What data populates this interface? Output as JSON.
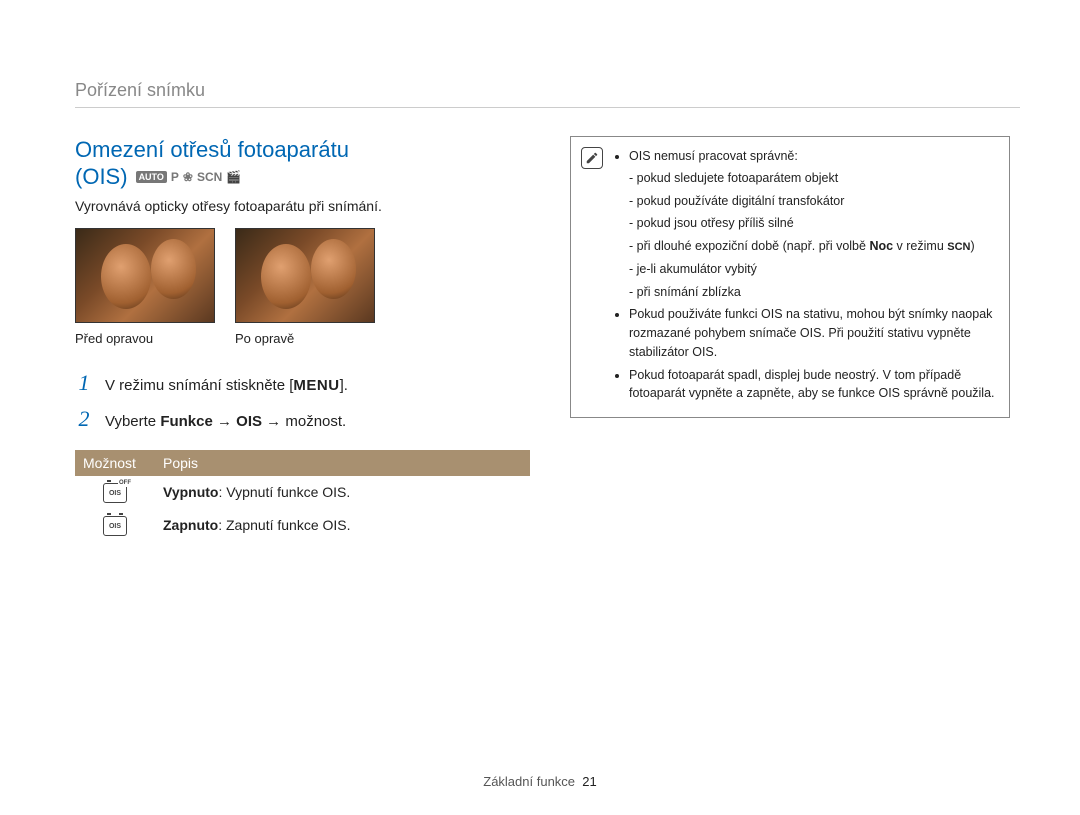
{
  "section_header": "Pořízení snímku",
  "title_line1": "Omezení otřesů fotoaparátu",
  "title_line2": "(OIS)",
  "mode_icons": {
    "auto": "AUTO",
    "p": "P",
    "plant": "❀",
    "scn": "SCN",
    "movie": "🎬"
  },
  "subtitle": "Vyrovnává opticky otřesy fotoaparátu při snímání.",
  "captions": {
    "before": "Před opravou",
    "after": "Po opravě"
  },
  "steps": {
    "s1": {
      "num": "1",
      "pre": "V režimu snímání stiskněte [",
      "key": "MENU",
      "post": "]."
    },
    "s2": {
      "num": "2",
      "pre": "Vyberte ",
      "b1": "Funkce",
      "arrow": " → ",
      "b2": "OIS",
      "post": " → možnost."
    }
  },
  "table": {
    "h1": "Možnost",
    "h2": "Popis",
    "r1": {
      "b": "Vypnuto",
      "t": ": Vypnutí funkce OIS."
    },
    "r2": {
      "b": "Zapnuto",
      "t": ": Zapnutí funkce OIS."
    }
  },
  "note": {
    "b1": "OIS nemusí pracovat správně:",
    "s1": "pokud sledujete fotoaparátem objekt",
    "s2": "pokud používáte digitální transfokátor",
    "s3": "pokud jsou otřesy příliš silné",
    "s4a": "při dlouhé expoziční době (např. při volbě ",
    "s4b": "Noc",
    "s4c": " v režimu ",
    "s4d": "SCN",
    "s4e": ")",
    "s5": "je-li akumulátor vybitý",
    "s6": "při snímání zblízka",
    "b2": "Pokud použiváte funkci OIS na stativu, mohou být snímky naopak rozmazané pohybem snímače OIS. Při použití stativu vypněte stabilizátor OIS.",
    "b3": "Pokud fotoaparát spadl, displej bude neostrý. V tom případě fotoaparát vypněte a zapněte, aby se funkce OIS správně použila."
  },
  "footer": {
    "label": "Základní funkce",
    "page": "21"
  }
}
